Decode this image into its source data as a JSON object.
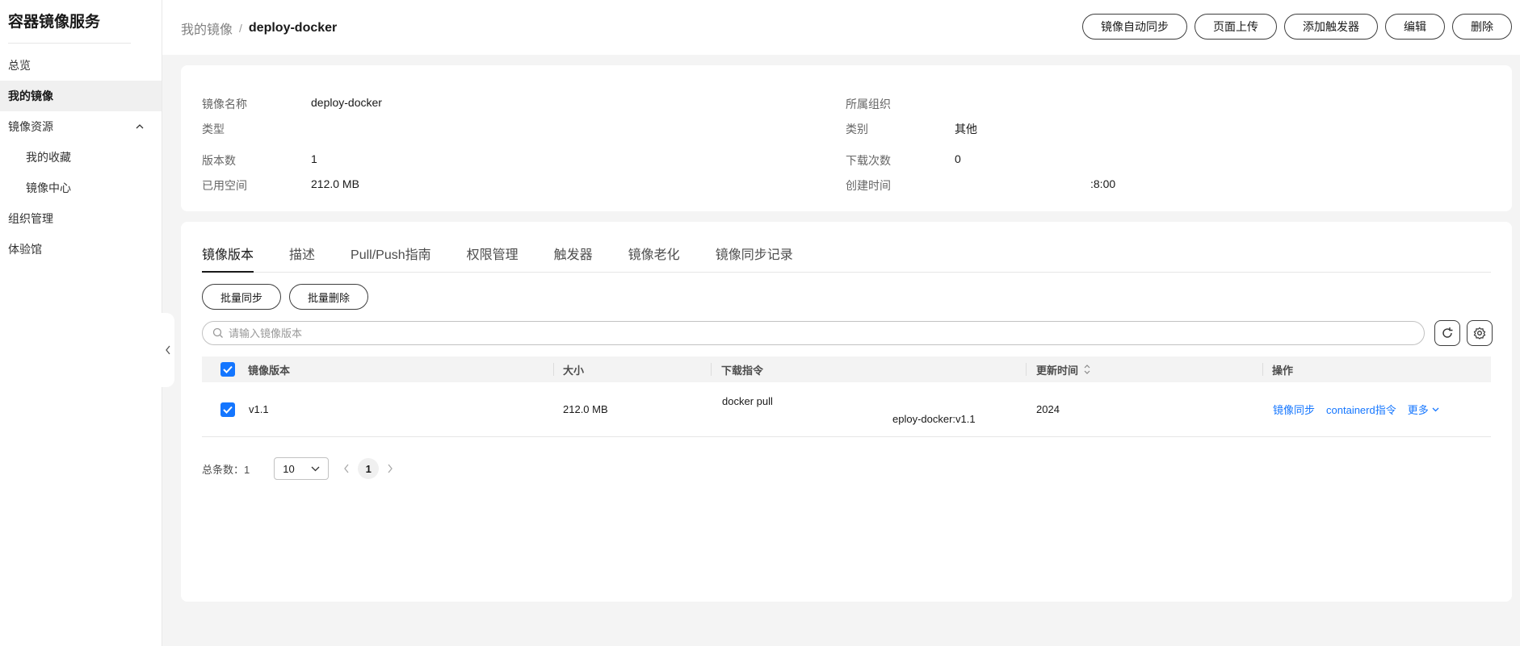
{
  "sidebar": {
    "title": "容器镜像服务",
    "items": [
      {
        "label": "总览"
      },
      {
        "label": "我的镜像"
      },
      {
        "label": "镜像资源"
      },
      {
        "label": "我的收藏"
      },
      {
        "label": "镜像中心"
      },
      {
        "label": "组织管理"
      },
      {
        "label": "体验馆"
      }
    ]
  },
  "header": {
    "breadcrumb_parent": "我的镜像",
    "breadcrumb_sep": "/",
    "breadcrumb_current": "deploy-docker",
    "actions": {
      "auto_sync": "镜像自动同步",
      "upload": "页面上传",
      "add_trigger": "添加触发器",
      "edit": "编辑",
      "delete": "删除"
    }
  },
  "info": {
    "name_label": "镜像名称",
    "name_value": "deploy-docker",
    "org_label": "所属组织",
    "org_value": "",
    "type_label": "类型",
    "type_value": "",
    "category_label": "类别",
    "category_value": "其他",
    "versions_label": "版本数",
    "versions_value": "1",
    "downloads_label": "下载次数",
    "downloads_value": "0",
    "space_label": "已用空间",
    "space_value": "212.0 MB",
    "created_label": "创建时间",
    "created_value": ":8:00"
  },
  "tabs": [
    "镜像版本",
    "描述",
    "Pull/Push指南",
    "权限管理",
    "触发器",
    "镜像老化",
    "镜像同步记录"
  ],
  "batch": {
    "sync": "批量同步",
    "delete": "批量删除"
  },
  "search": {
    "placeholder": "请输入镜像版本"
  },
  "table": {
    "headers": {
      "version": "镜像版本",
      "size": "大小",
      "command": "下载指令",
      "updated": "更新时间",
      "ops": "操作"
    },
    "rows": [
      {
        "version": "v1.1",
        "size": "212.0 MB",
        "command_line1": "docker pull",
        "command_line2": "eploy-docker:v1.1",
        "updated": "2024",
        "op_sync": "镜像同步",
        "op_containerd": "containerd指令",
        "op_more": "更多"
      }
    ]
  },
  "pagination": {
    "total_label": "总条数：1",
    "page_size": "10",
    "current_page": "1"
  },
  "colors": {
    "accent": "#1476ff",
    "text": "#191919",
    "muted": "#666666"
  }
}
